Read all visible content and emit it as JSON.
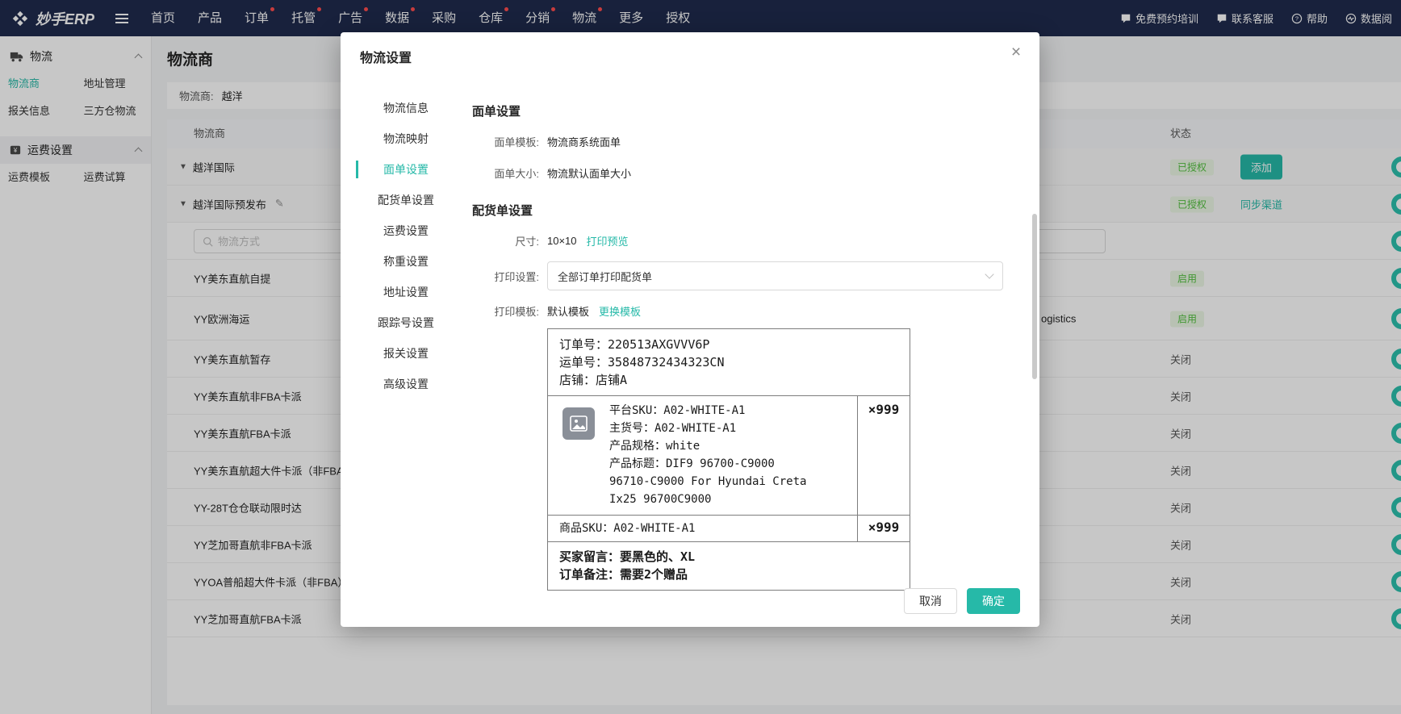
{
  "colors": {
    "accent_teal": "#26b9a8",
    "nav_navy": "#1f2b4d",
    "status_green": "#54c141",
    "notification_red": "#ff4d4f"
  },
  "topnav": {
    "logo": "妙手ERP",
    "items": [
      {
        "label": "首页",
        "dot": false
      },
      {
        "label": "产品",
        "dot": false
      },
      {
        "label": "订单",
        "dot": true
      },
      {
        "label": "托管",
        "dot": true
      },
      {
        "label": "广告",
        "dot": true
      },
      {
        "label": "数据",
        "dot": true
      },
      {
        "label": "采购",
        "dot": false
      },
      {
        "label": "仓库",
        "dot": true
      },
      {
        "label": "分销",
        "dot": true
      },
      {
        "label": "物流",
        "dot": true
      },
      {
        "label": "更多",
        "dot": false
      },
      {
        "label": "授权",
        "dot": false
      }
    ],
    "right_items": [
      {
        "label": "免费预约培训",
        "icon": "chat-icon"
      },
      {
        "label": "联系客服",
        "icon": "chat-icon"
      },
      {
        "label": "帮助",
        "icon": "help-icon"
      },
      {
        "label": "数据阅",
        "icon": "data-icon"
      }
    ]
  },
  "sidebar": {
    "sections": [
      {
        "title": "物流",
        "icon": "truck-icon",
        "items": [
          {
            "label": "物流商",
            "active": true
          },
          {
            "label": "地址管理",
            "active": false
          },
          {
            "label": "报关信息",
            "active": false
          },
          {
            "label": "三方仓物流",
            "active": false
          }
        ]
      },
      {
        "title": "运费设置",
        "icon": "freight-icon",
        "items": [
          {
            "label": "运费模板",
            "active": false
          },
          {
            "label": "运费试算",
            "active": false
          }
        ]
      }
    ]
  },
  "main": {
    "page_title": "物流商",
    "filter": {
      "label": "物流商:",
      "value": "越洋"
    },
    "table": {
      "headers": {
        "provider": "物流商",
        "status": "状态"
      },
      "groups": [
        {
          "name": "越洋国际",
          "status": "已授权",
          "action": "添加"
        },
        {
          "name": "越洋国际预发布",
          "status": "已授权",
          "action": "同步渠道"
        }
      ],
      "search_placeholder": "物流方式",
      "rows": [
        {
          "name": "YY美东直航自提",
          "status": "启用"
        },
        {
          "name": "YY欧洲海运",
          "partner": "ogistics",
          "status": "启用"
        },
        {
          "name": "YY美东直航暂存",
          "status": "关闭"
        },
        {
          "name": "YY美东直航非FBA卡派",
          "status": "关闭"
        },
        {
          "name": "YY美东直航FBA卡派",
          "status": "关闭"
        },
        {
          "name": "YY美东直航超大件卡派（非FBA）",
          "status": "关闭"
        },
        {
          "name": "YY-28T仓仓联动限时达",
          "status": "关闭"
        },
        {
          "name": "YY芝加哥直航非FBA卡派",
          "status": "关闭"
        },
        {
          "name": "YYOA普船超大件卡派（非FBA）",
          "status": "关闭"
        },
        {
          "name": "YY芝加哥直航FBA卡派",
          "status": "关闭"
        }
      ]
    }
  },
  "modal": {
    "title": "物流设置",
    "tabs": [
      {
        "label": "物流信息"
      },
      {
        "label": "物流映射"
      },
      {
        "label": "面单设置"
      },
      {
        "label": "配货单设置"
      },
      {
        "label": "运费设置"
      },
      {
        "label": "称重设置"
      },
      {
        "label": "地址设置"
      },
      {
        "label": "跟踪号设置"
      },
      {
        "label": "报关设置"
      },
      {
        "label": "高级设置"
      }
    ],
    "active_tab": "面单设置",
    "face_sheet": {
      "heading": "面单设置",
      "template_label": "面单模板:",
      "template_value": "物流商系统面单",
      "size_label": "面单大小:",
      "size_value": "物流默认面单大小"
    },
    "picking": {
      "heading": "配货单设置",
      "size_label": "尺寸:",
      "size_value": "10×10",
      "preview_link": "打印预览",
      "print_label": "打印设置:",
      "print_value": "全部订单打印配货单",
      "template_label": "打印模板:",
      "template_value": "默认模板",
      "change_link": "更换模板"
    },
    "preview": {
      "order_no": "订单号：220513AXGVVV6P",
      "waybill_no": "运单号：35848732434323CN",
      "shop": "店铺：店铺A",
      "product_lines": [
        "平台SKU：A02-WHITE-A1",
        "主货号：A02-WHITE-A1",
        "产品规格：white",
        "产品标题：DIF9 96700-C9000",
        "96710-C9000 For Hyundai Creta",
        "Ix25 96700C9000"
      ],
      "qty": "×999",
      "sku_line": "商品SKU：A02-WHITE-A1",
      "sku_qty": "×999",
      "buyer_note": "买家留言：要黑色的、XL",
      "order_note": "订单备注：需要2个赠品"
    },
    "footer": {
      "cancel": "取消",
      "confirm": "确定"
    }
  }
}
